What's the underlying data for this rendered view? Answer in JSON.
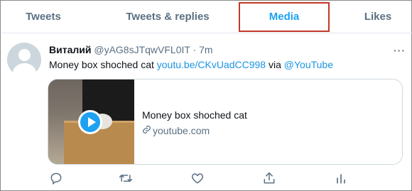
{
  "tabs": [
    {
      "label": "Tweets"
    },
    {
      "label": "Tweets & replies"
    },
    {
      "label": "Media"
    },
    {
      "label": "Likes"
    }
  ],
  "tweet": {
    "name": "Виталий",
    "handle": "@yAG8sJTqwVFL0IT",
    "separator": "·",
    "time": "7m",
    "more": "···",
    "text_prefix": "Money box shoched cat",
    "link": "youtu.be/CKvUadCC998",
    "via": "via",
    "mention": "@YouTube",
    "card": {
      "title": "Money box shoched cat",
      "domain": "youtube.com"
    }
  },
  "colors": {
    "accent": "#1da1f2",
    "highlight_border": "#c0392b",
    "muted": "#5b7083"
  },
  "icons": [
    "reply-icon",
    "retweet-icon",
    "like-icon",
    "share-icon",
    "analytics-icon",
    "link-icon",
    "play-icon"
  ]
}
